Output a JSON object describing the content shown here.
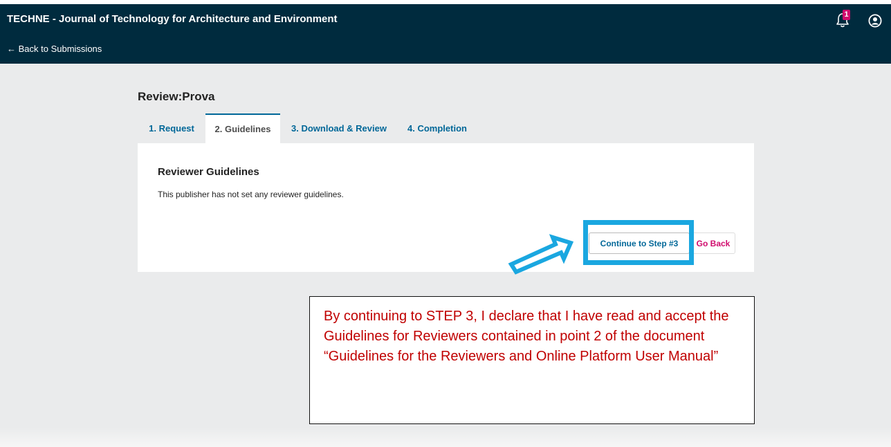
{
  "header": {
    "site_title": "TECHNE - Journal of Technology for Architecture and Environment",
    "back_link": "← Back to Submissions",
    "notification_count": "1",
    "icons": {
      "notifications": "bell-icon",
      "user": "user-account-icon"
    },
    "colors": {
      "bar": "#002b3e",
      "badge": "#d00a6c"
    }
  },
  "page": {
    "title": "Review:Prova",
    "tabs": [
      {
        "label": "1. Request",
        "active": false
      },
      {
        "label": "2. Guidelines",
        "active": true
      },
      {
        "label": "3. Download & Review",
        "active": false
      },
      {
        "label": "4. Completion",
        "active": false
      }
    ]
  },
  "guidelines": {
    "heading": "Reviewer Guidelines",
    "text": "This publisher has not set any reviewer guidelines.",
    "continue_label": "Continue to Step #3",
    "goback_label": "Go Back"
  },
  "annotation": {
    "note": "By continuing to STEP 3, I declare that I have read and accept the Guidelines for Reviewers contained in point 2 of the document “Guidelines for the Reviewers and Online Platform User Manual”",
    "colors": {
      "highlight": "#1aa7e0",
      "note_text": "#c00000"
    }
  },
  "colors": {
    "accent": "#006798",
    "danger": "#d00a6c",
    "background": "#eaebec"
  }
}
